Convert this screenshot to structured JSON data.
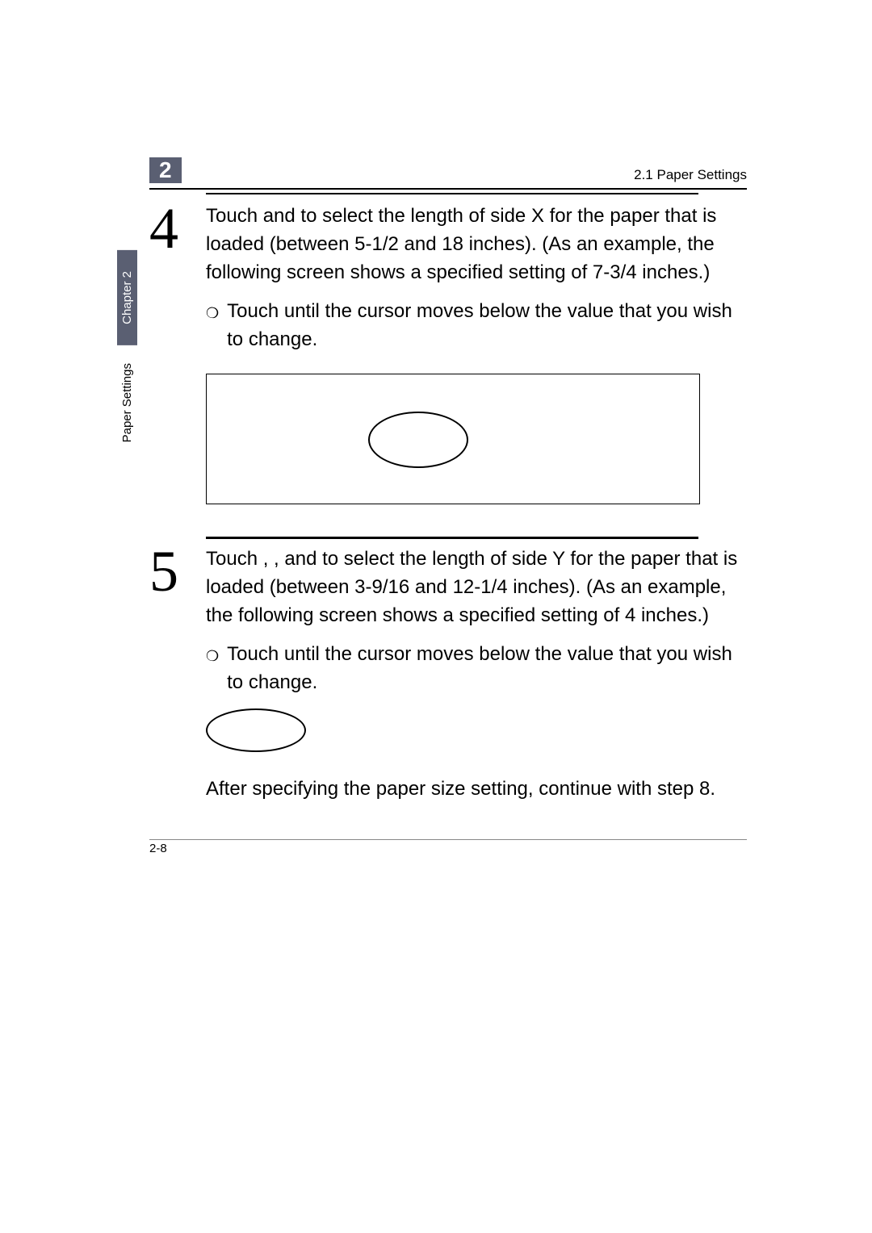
{
  "header": {
    "chapter_num": "2",
    "section_title": "2.1 Paper Settings"
  },
  "sidetab": {
    "chapter_label": "Chapter 2",
    "section_label": "Paper Settings"
  },
  "step4": {
    "num": "4",
    "body": "Touch         and         to select the length of side X for the paper that is loaded (between 5-1/2 and 18 inches). (As an example, the following screen shows a specified setting of 7-3/4 inches.)",
    "sub": "Touch           until the cursor moves below the value that you wish to change."
  },
  "step5": {
    "num": "5",
    "body": "Touch          ,          , and         to select the length of side Y for the paper that is loaded (between 3-9/16 and 12-1/4 inches). (As an example, the following screen shows a specified setting of 4 inches.)",
    "sub": "Touch           until the cursor moves below the value that you wish to change.",
    "after": "After specifying the paper size setting, continue with step 8."
  },
  "footer": {
    "page_num": "2-8"
  }
}
